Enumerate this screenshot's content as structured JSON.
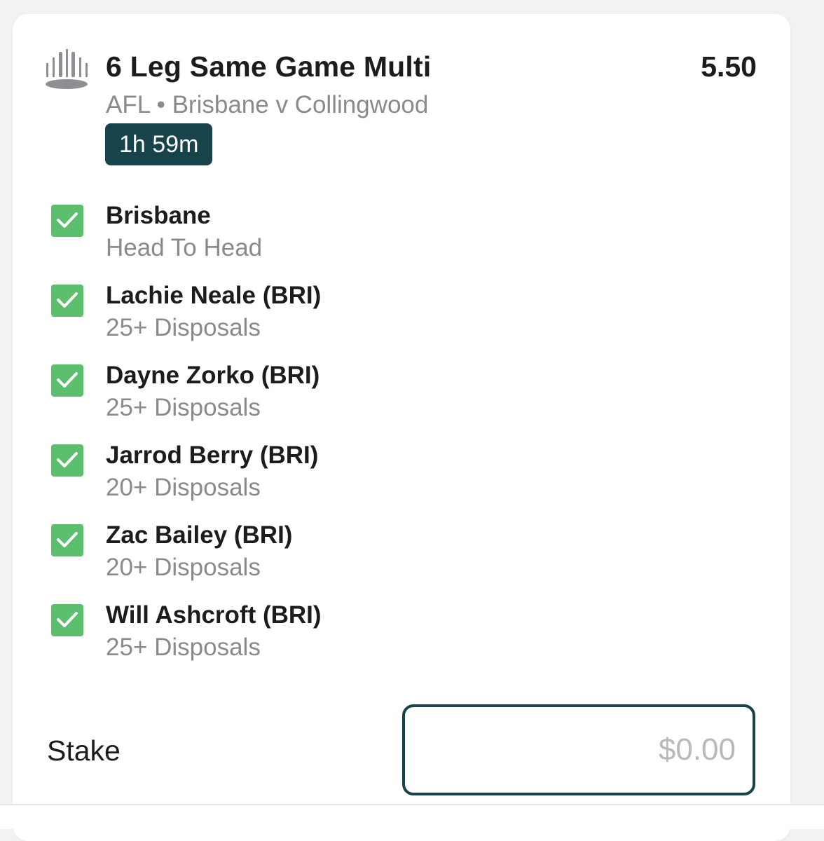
{
  "bet": {
    "title": "6 Leg Same Game Multi",
    "odds": "5.50",
    "subtitle": "AFL • Brisbane v Collingwood",
    "timer": "1h 59m",
    "icon": "stadium-icon"
  },
  "legs": [
    {
      "name": "Brisbane",
      "market": "Head To Head",
      "checked": true
    },
    {
      "name": "Lachie Neale (BRI)",
      "market": "25+ Disposals",
      "checked": true
    },
    {
      "name": "Dayne Zorko (BRI)",
      "market": "25+ Disposals",
      "checked": true
    },
    {
      "name": "Jarrod Berry (BRI)",
      "market": "20+ Disposals",
      "checked": true
    },
    {
      "name": "Zac Bailey (BRI)",
      "market": "20+ Disposals",
      "checked": true
    },
    {
      "name": "Will Ashcroft (BRI)",
      "market": "25+ Disposals",
      "checked": true
    }
  ],
  "stake": {
    "label": "Stake",
    "placeholder": "$0.00",
    "value": ""
  },
  "colors": {
    "accent": "#17444a",
    "check": "#5cbf6e",
    "muted_text": "#8a8a8e"
  }
}
